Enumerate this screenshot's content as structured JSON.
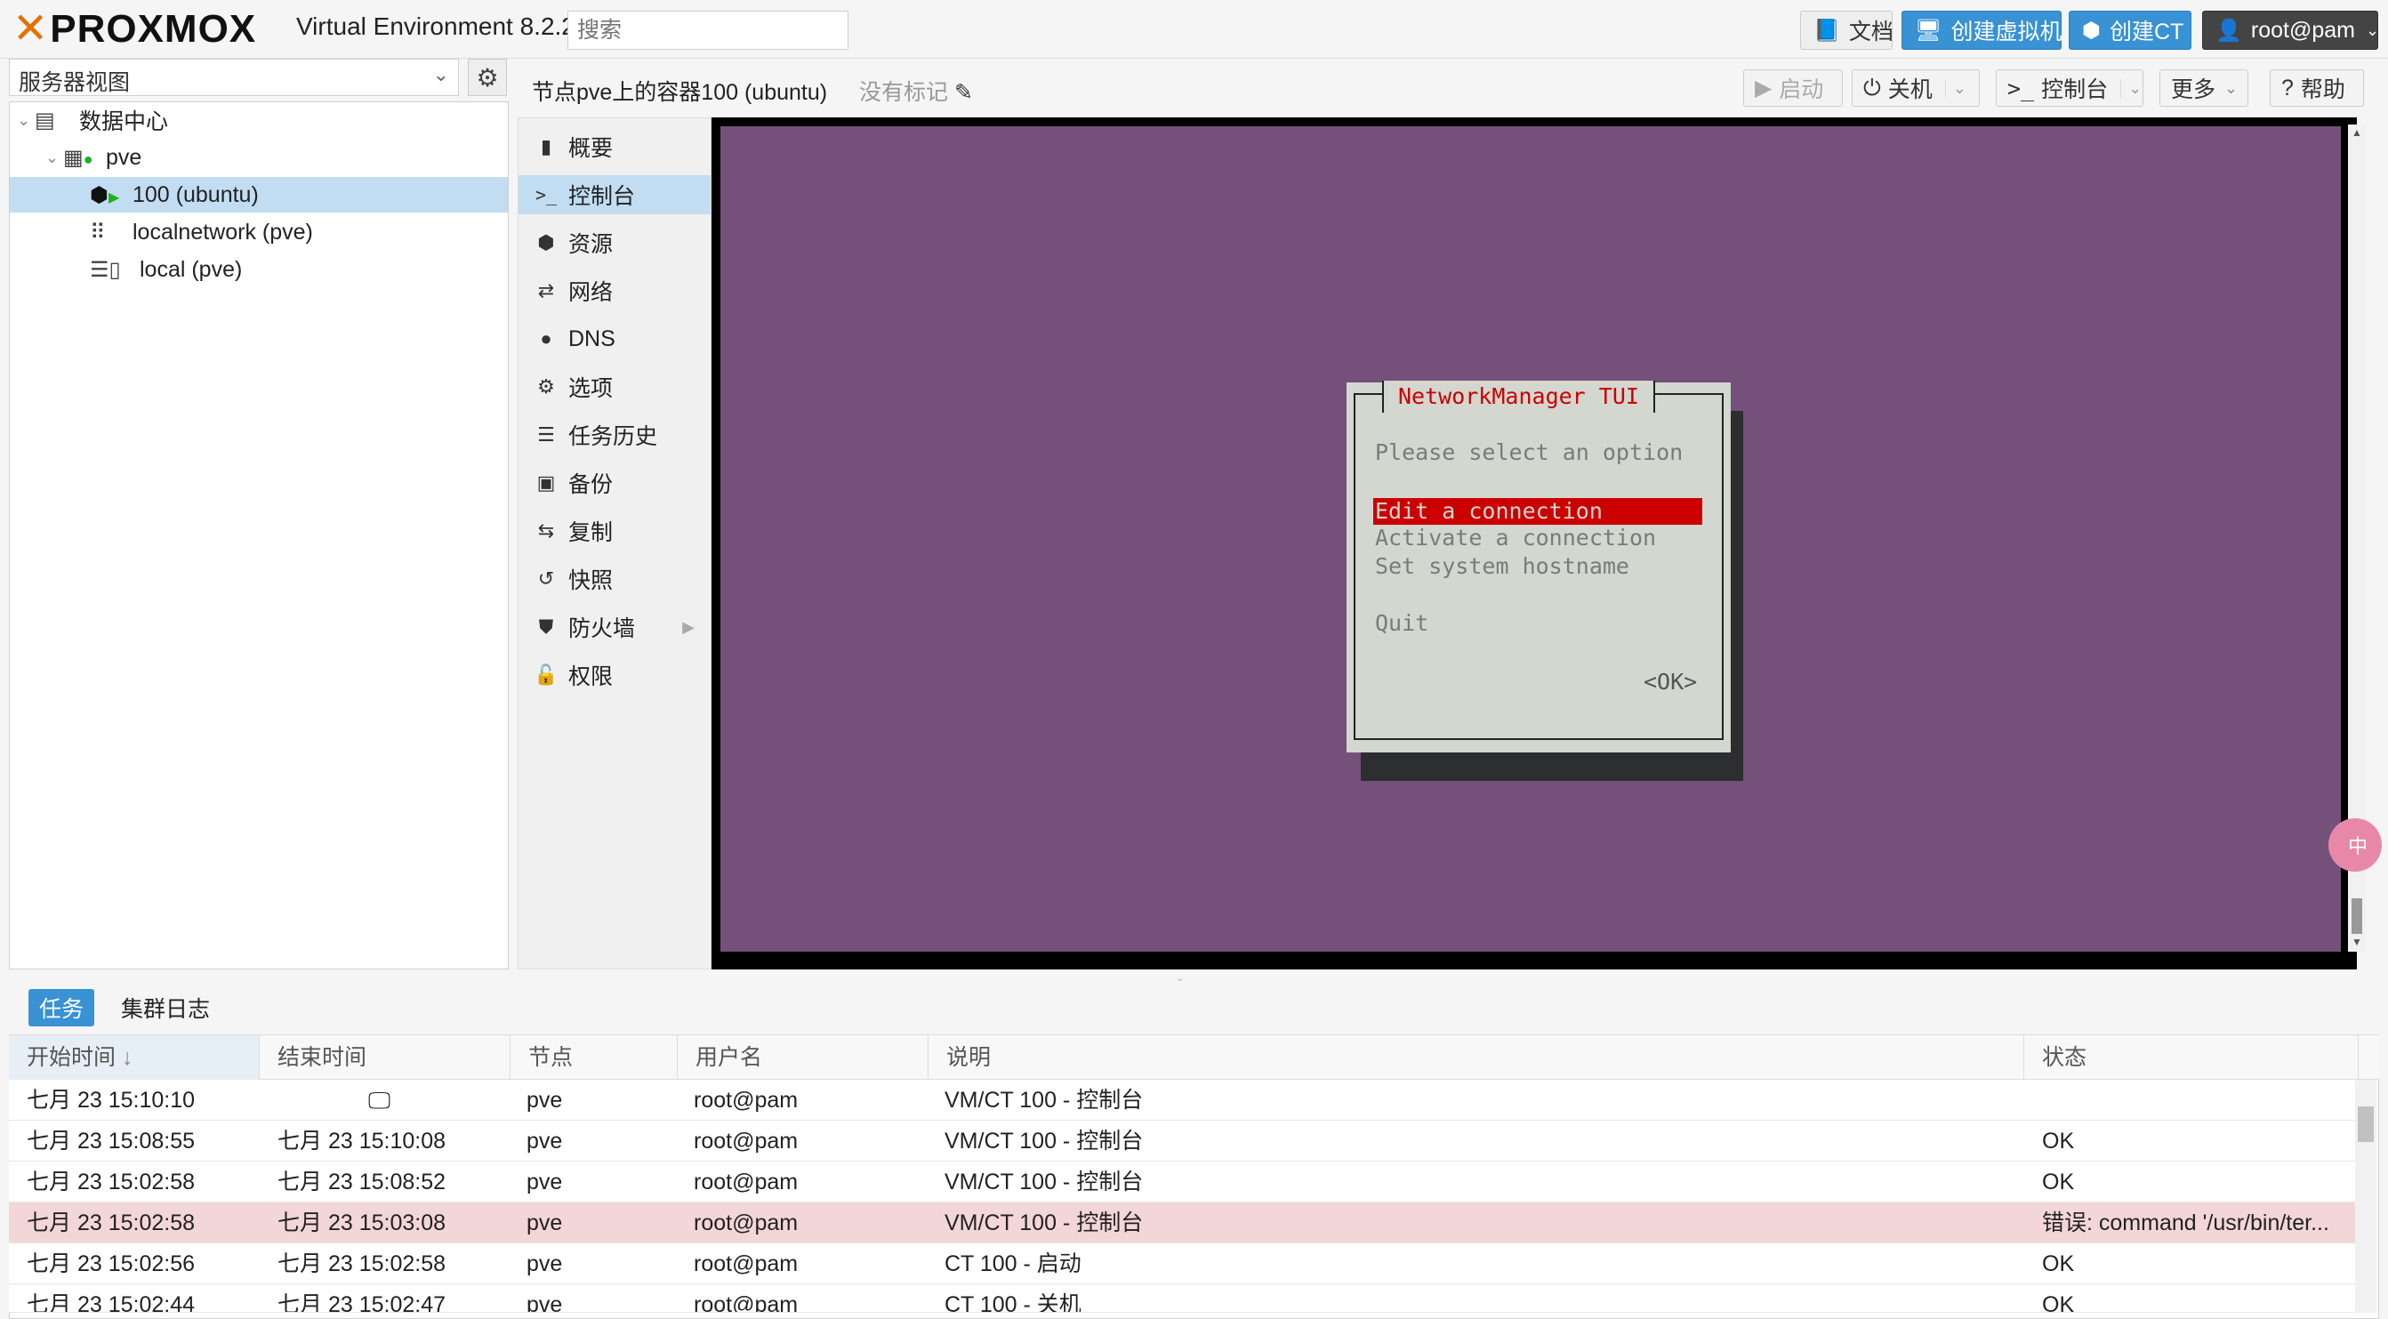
{
  "topbar": {
    "logo_text": "PROXMOX",
    "version_text": "Virtual Environment 8.2.2",
    "search_placeholder": "搜索",
    "docs_label": "文档",
    "create_vm_label": "创建虚拟机",
    "create_ct_label": "创建CT",
    "user_label": "root@pam"
  },
  "left": {
    "view_selector": "服务器视图",
    "tree": [
      {
        "label": "数据中心"
      },
      {
        "label": "pve"
      },
      {
        "label": "100 (ubuntu)"
      },
      {
        "label": "localnetwork (pve)"
      },
      {
        "label": "local (pve)"
      }
    ]
  },
  "content": {
    "title": "节点pve上的容器100 (ubuntu)",
    "tags_label": "没有标记",
    "buttons": {
      "start": "启动",
      "shutdown": "关机",
      "console": "控制台",
      "more": "更多",
      "help": "帮助"
    },
    "nav": [
      {
        "label": "概要",
        "icon": "book-icon"
      },
      {
        "label": "控制台",
        "icon": "terminal-icon"
      },
      {
        "label": "资源",
        "icon": "cube-icon"
      },
      {
        "label": "网络",
        "icon": "exchange-icon"
      },
      {
        "label": "DNS",
        "icon": "globe-icon"
      },
      {
        "label": "选项",
        "icon": "gear-icon"
      },
      {
        "label": "任务历史",
        "icon": "list-icon"
      },
      {
        "label": "备份",
        "icon": "floppy-icon"
      },
      {
        "label": "复制",
        "icon": "retweet-icon"
      },
      {
        "label": "快照",
        "icon": "history-icon"
      },
      {
        "label": "防火墙",
        "icon": "shield-icon"
      },
      {
        "label": "权限",
        "icon": "unlock-icon"
      }
    ]
  },
  "terminal": {
    "dialog_title": "NetworkManager TUI",
    "prompt": "Please select an option",
    "options": [
      "Edit a connection",
      "Activate a connection",
      "Set system hostname"
    ],
    "quit": "Quit",
    "ok": "<OK>",
    "colors": {
      "background": "#75507b",
      "dialog": "#d3d7cf",
      "highlight": "#cc0000"
    }
  },
  "tasks": {
    "tabs": [
      "任务",
      "集群日志"
    ],
    "columns": [
      "开始时间",
      "结束时间",
      "节点",
      "用户名",
      "说明",
      "状态"
    ],
    "rows": [
      {
        "start": "七月 23 15:10:10",
        "end": "",
        "node": "pve",
        "user": "root@pam",
        "desc": "VM/CT 100 - 控制台",
        "status": ""
      },
      {
        "start": "七月 23 15:08:55",
        "end": "七月 23 15:10:08",
        "node": "pve",
        "user": "root@pam",
        "desc": "VM/CT 100 - 控制台",
        "status": "OK"
      },
      {
        "start": "七月 23 15:02:58",
        "end": "七月 23 15:08:52",
        "node": "pve",
        "user": "root@pam",
        "desc": "VM/CT 100 - 控制台",
        "status": "OK"
      },
      {
        "start": "七月 23 15:02:58",
        "end": "七月 23 15:03:08",
        "node": "pve",
        "user": "root@pam",
        "desc": "VM/CT 100 - 控制台",
        "status": "错误: command '/usr/bin/ter..."
      },
      {
        "start": "七月 23 15:02:56",
        "end": "七月 23 15:02:58",
        "node": "pve",
        "user": "root@pam",
        "desc": "CT 100 - 启动",
        "status": "OK"
      },
      {
        "start": "七月 23 15:02:44",
        "end": "七月 23 15:02:47",
        "node": "pve",
        "user": "root@pam",
        "desc": "CT 100 - 关机",
        "status": "OK"
      }
    ]
  },
  "side_badge": "中"
}
